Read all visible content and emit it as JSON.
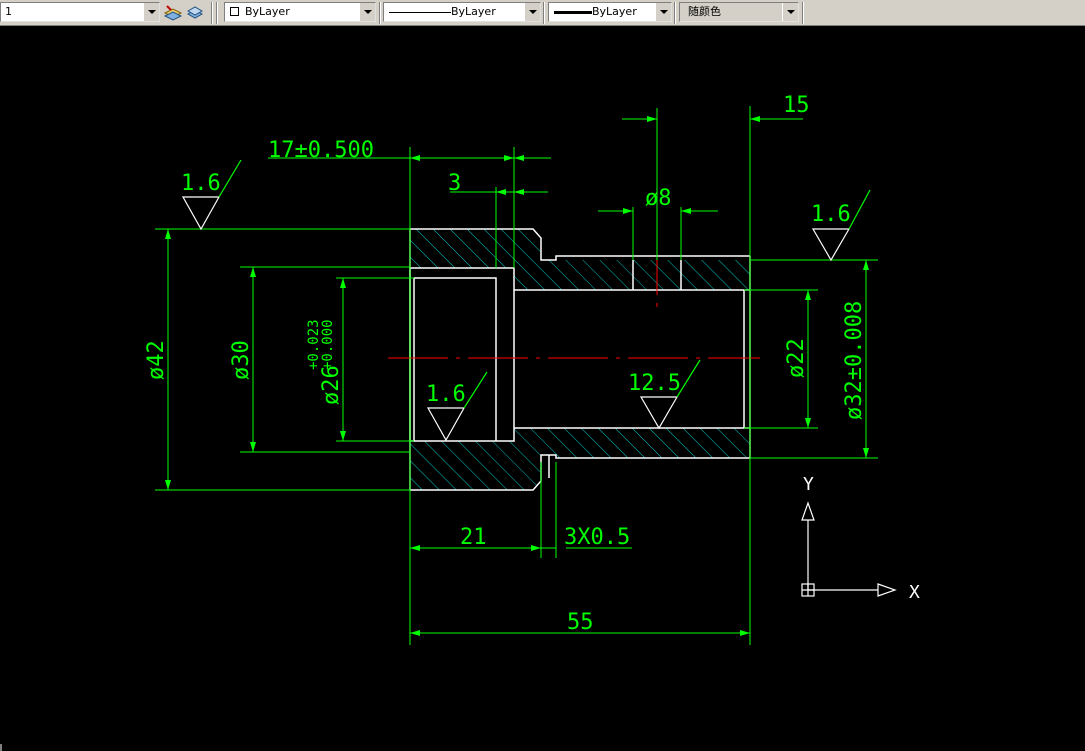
{
  "toolbar": {
    "layer_value": "1",
    "color_value": "ByLayer",
    "linetype_value": "ByLayer",
    "lineweight_value": "ByLayer",
    "plotstyle_value": "随颜色"
  },
  "drawing": {
    "dim_17": "17±0.500",
    "dim_3": "3",
    "dim_15": "15",
    "dim_d8": "ø8",
    "rough_top_left": "1.6",
    "rough_top_right": "1.6",
    "rough_inner": "1.6",
    "rough_bore": "12.5",
    "dim_d42": "ø42",
    "dim_d30": "ø30",
    "dim_d26": "ø26",
    "dim_d26_tol_upper": "+0.023",
    "dim_d26_tol_lower": "+0.000",
    "dim_d22": "ø22",
    "dim_d32": "ø32±0.008",
    "dim_21": "21",
    "dim_groove": "3X0.5",
    "dim_55": "55",
    "ucs_x": "X",
    "ucs_y": "Y"
  },
  "colors": {
    "background": "#000000",
    "dimension": "#00ff00",
    "outline": "#ffffff",
    "hatch": "#00c8c8",
    "centerline": "#ff0000"
  }
}
